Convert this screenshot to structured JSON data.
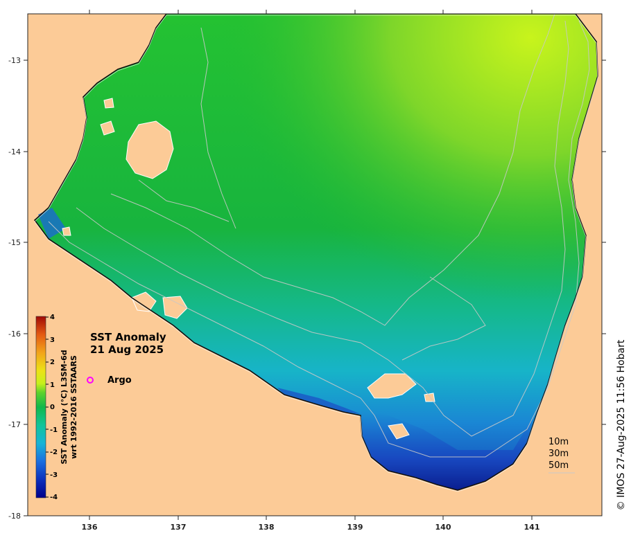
{
  "title": {
    "line1": "SST Anomaly",
    "line2": "21 Aug 2025"
  },
  "legend": {
    "argo_label": "Argo",
    "argo_color": "#ff00ff"
  },
  "colorbar": {
    "label_line1": "SST Anomaly (°C) L3SM-6d",
    "label_line2": "wrt 1992-2016 SSTAARS",
    "ticks": [
      "4",
      "3",
      "2",
      "1",
      "0",
      "-1",
      "-2",
      "-3",
      "-4"
    ],
    "min": -4,
    "max": 4
  },
  "depth_contours": {
    "labels": [
      "10m",
      "30m",
      "50m"
    ]
  },
  "axes": {
    "x_ticks": [
      "136",
      "137",
      "138",
      "139",
      "140",
      "141"
    ],
    "y_ticks": [
      "-13",
      "-14",
      "-15",
      "-16",
      "-17",
      "-18"
    ]
  },
  "credit": "© IMOS 27-Aug-2025 11:56 Hobart",
  "colors": {
    "land": "#fccb97",
    "sea_warm": "#b8ef1a",
    "sea_mid": "#20c030",
    "sea_cool": "#1ab8c8",
    "sea_cold": "#1a3cb4"
  }
}
